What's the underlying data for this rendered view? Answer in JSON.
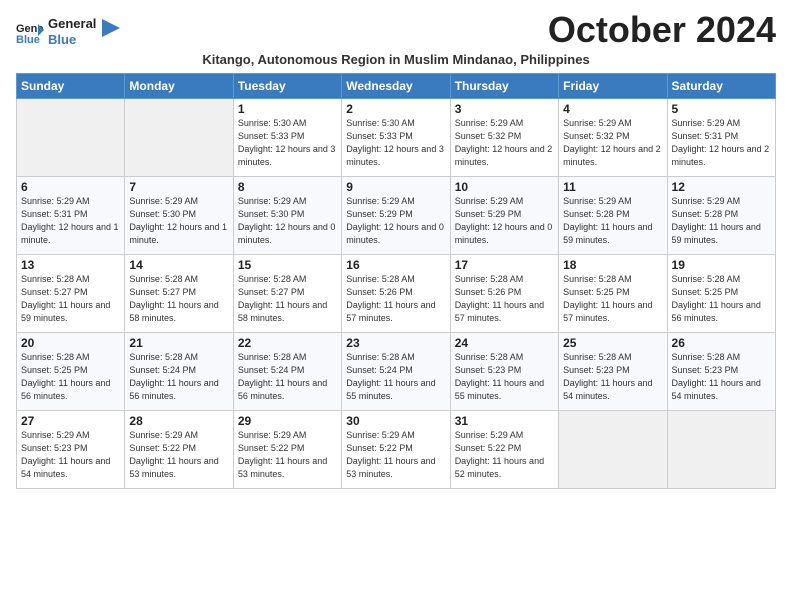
{
  "logo": {
    "line1": "General",
    "line2": "Blue"
  },
  "title": "October 2024",
  "subtitle": "Kitango, Autonomous Region in Muslim Mindanao, Philippines",
  "days_of_week": [
    "Sunday",
    "Monday",
    "Tuesday",
    "Wednesday",
    "Thursday",
    "Friday",
    "Saturday"
  ],
  "weeks": [
    [
      {
        "num": "",
        "info": ""
      },
      {
        "num": "",
        "info": ""
      },
      {
        "num": "1",
        "info": "Sunrise: 5:30 AM\nSunset: 5:33 PM\nDaylight: 12 hours and 3 minutes."
      },
      {
        "num": "2",
        "info": "Sunrise: 5:30 AM\nSunset: 5:33 PM\nDaylight: 12 hours and 3 minutes."
      },
      {
        "num": "3",
        "info": "Sunrise: 5:29 AM\nSunset: 5:32 PM\nDaylight: 12 hours and 2 minutes."
      },
      {
        "num": "4",
        "info": "Sunrise: 5:29 AM\nSunset: 5:32 PM\nDaylight: 12 hours and 2 minutes."
      },
      {
        "num": "5",
        "info": "Sunrise: 5:29 AM\nSunset: 5:31 PM\nDaylight: 12 hours and 2 minutes."
      }
    ],
    [
      {
        "num": "6",
        "info": "Sunrise: 5:29 AM\nSunset: 5:31 PM\nDaylight: 12 hours and 1 minute."
      },
      {
        "num": "7",
        "info": "Sunrise: 5:29 AM\nSunset: 5:30 PM\nDaylight: 12 hours and 1 minute."
      },
      {
        "num": "8",
        "info": "Sunrise: 5:29 AM\nSunset: 5:30 PM\nDaylight: 12 hours and 0 minutes."
      },
      {
        "num": "9",
        "info": "Sunrise: 5:29 AM\nSunset: 5:29 PM\nDaylight: 12 hours and 0 minutes."
      },
      {
        "num": "10",
        "info": "Sunrise: 5:29 AM\nSunset: 5:29 PM\nDaylight: 12 hours and 0 minutes."
      },
      {
        "num": "11",
        "info": "Sunrise: 5:29 AM\nSunset: 5:28 PM\nDaylight: 11 hours and 59 minutes."
      },
      {
        "num": "12",
        "info": "Sunrise: 5:29 AM\nSunset: 5:28 PM\nDaylight: 11 hours and 59 minutes."
      }
    ],
    [
      {
        "num": "13",
        "info": "Sunrise: 5:28 AM\nSunset: 5:27 PM\nDaylight: 11 hours and 59 minutes."
      },
      {
        "num": "14",
        "info": "Sunrise: 5:28 AM\nSunset: 5:27 PM\nDaylight: 11 hours and 58 minutes."
      },
      {
        "num": "15",
        "info": "Sunrise: 5:28 AM\nSunset: 5:27 PM\nDaylight: 11 hours and 58 minutes."
      },
      {
        "num": "16",
        "info": "Sunrise: 5:28 AM\nSunset: 5:26 PM\nDaylight: 11 hours and 57 minutes."
      },
      {
        "num": "17",
        "info": "Sunrise: 5:28 AM\nSunset: 5:26 PM\nDaylight: 11 hours and 57 minutes."
      },
      {
        "num": "18",
        "info": "Sunrise: 5:28 AM\nSunset: 5:25 PM\nDaylight: 11 hours and 57 minutes."
      },
      {
        "num": "19",
        "info": "Sunrise: 5:28 AM\nSunset: 5:25 PM\nDaylight: 11 hours and 56 minutes."
      }
    ],
    [
      {
        "num": "20",
        "info": "Sunrise: 5:28 AM\nSunset: 5:25 PM\nDaylight: 11 hours and 56 minutes."
      },
      {
        "num": "21",
        "info": "Sunrise: 5:28 AM\nSunset: 5:24 PM\nDaylight: 11 hours and 56 minutes."
      },
      {
        "num": "22",
        "info": "Sunrise: 5:28 AM\nSunset: 5:24 PM\nDaylight: 11 hours and 56 minutes."
      },
      {
        "num": "23",
        "info": "Sunrise: 5:28 AM\nSunset: 5:24 PM\nDaylight: 11 hours and 55 minutes."
      },
      {
        "num": "24",
        "info": "Sunrise: 5:28 AM\nSunset: 5:23 PM\nDaylight: 11 hours and 55 minutes."
      },
      {
        "num": "25",
        "info": "Sunrise: 5:28 AM\nSunset: 5:23 PM\nDaylight: 11 hours and 54 minutes."
      },
      {
        "num": "26",
        "info": "Sunrise: 5:28 AM\nSunset: 5:23 PM\nDaylight: 11 hours and 54 minutes."
      }
    ],
    [
      {
        "num": "27",
        "info": "Sunrise: 5:29 AM\nSunset: 5:23 PM\nDaylight: 11 hours and 54 minutes."
      },
      {
        "num": "28",
        "info": "Sunrise: 5:29 AM\nSunset: 5:22 PM\nDaylight: 11 hours and 53 minutes."
      },
      {
        "num": "29",
        "info": "Sunrise: 5:29 AM\nSunset: 5:22 PM\nDaylight: 11 hours and 53 minutes."
      },
      {
        "num": "30",
        "info": "Sunrise: 5:29 AM\nSunset: 5:22 PM\nDaylight: 11 hours and 53 minutes."
      },
      {
        "num": "31",
        "info": "Sunrise: 5:29 AM\nSunset: 5:22 PM\nDaylight: 11 hours and 52 minutes."
      },
      {
        "num": "",
        "info": ""
      },
      {
        "num": "",
        "info": ""
      }
    ]
  ]
}
